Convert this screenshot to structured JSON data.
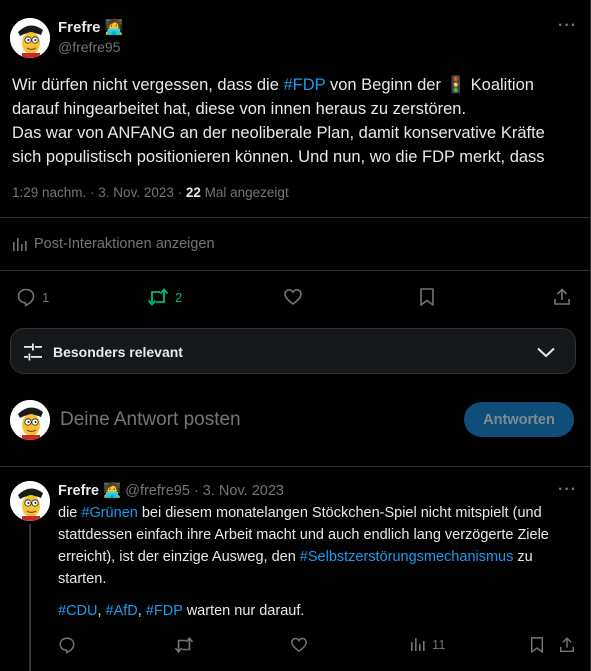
{
  "post": {
    "author_name": "Frefre",
    "author_emoji": "🧑‍💻",
    "handle": "@frefre95",
    "body": {
      "l1a": "Wir dürfen nicht vergessen, dass die ",
      "l1_hashtag": "#FDP",
      "l1b": " von Beginn der ",
      "l1_emoji": "🚦",
      "l1c": " Koalition",
      "l2": "darauf hingearbeitet hat, diese von innen heraus zu zerstören.",
      "l3": "Das war von ANFANG an der neoliberale Plan, damit konservative Kräfte",
      "l4": "sich populistisch positionieren können. Und nun, wo die FDP merkt, dass"
    },
    "time": "1:29 nachm.",
    "sep": " · ",
    "date": "3. Nov. 2023",
    "views_count": "22",
    "views_label": " Mal angezeigt",
    "analytics_label": "Post-Interaktionen anzeigen",
    "actions": {
      "replies": "1",
      "reposts": "2"
    }
  },
  "filter": {
    "label": "Besonders relevant"
  },
  "compose": {
    "placeholder": "Deine Antwort posten",
    "button": "Antworten"
  },
  "reply": {
    "author_name": "Frefre",
    "author_emoji": "🧑‍💻",
    "meta": " @frefre95 · 3. Nov. 2023",
    "body": {
      "l1a": "die ",
      "l1_hashtag": "#Grünen",
      "l1b": " bei diesem monatelangen Stöckchen-Spiel nicht mitspielt (und",
      "l2": "stattdessen einfach ihre Arbeit macht und auch endlich lang verzögerte Ziele",
      "l3a": "erreicht), ist der einzige Ausweg, den ",
      "l3_hashtag": "#Selbstzerstörungsmechanismus",
      "l3b": " zu",
      "l4": "starten.",
      "h1": "#CDU",
      "c1": ", ",
      "h2": "#AfD",
      "c2": ", ",
      "h3": "#FDP",
      "tail": " warten nur darauf."
    },
    "views": "11"
  },
  "colors": {
    "accent": "#1d9bf0",
    "repost_active": "#00ba7c",
    "muted": "#71767b",
    "background": "#000000"
  },
  "icons": [
    "more-icon",
    "chart-icon",
    "reply-icon",
    "repost-icon",
    "like-icon",
    "bookmark-icon",
    "share-icon",
    "filter-icon",
    "chevron-down-icon",
    "avatar"
  ]
}
